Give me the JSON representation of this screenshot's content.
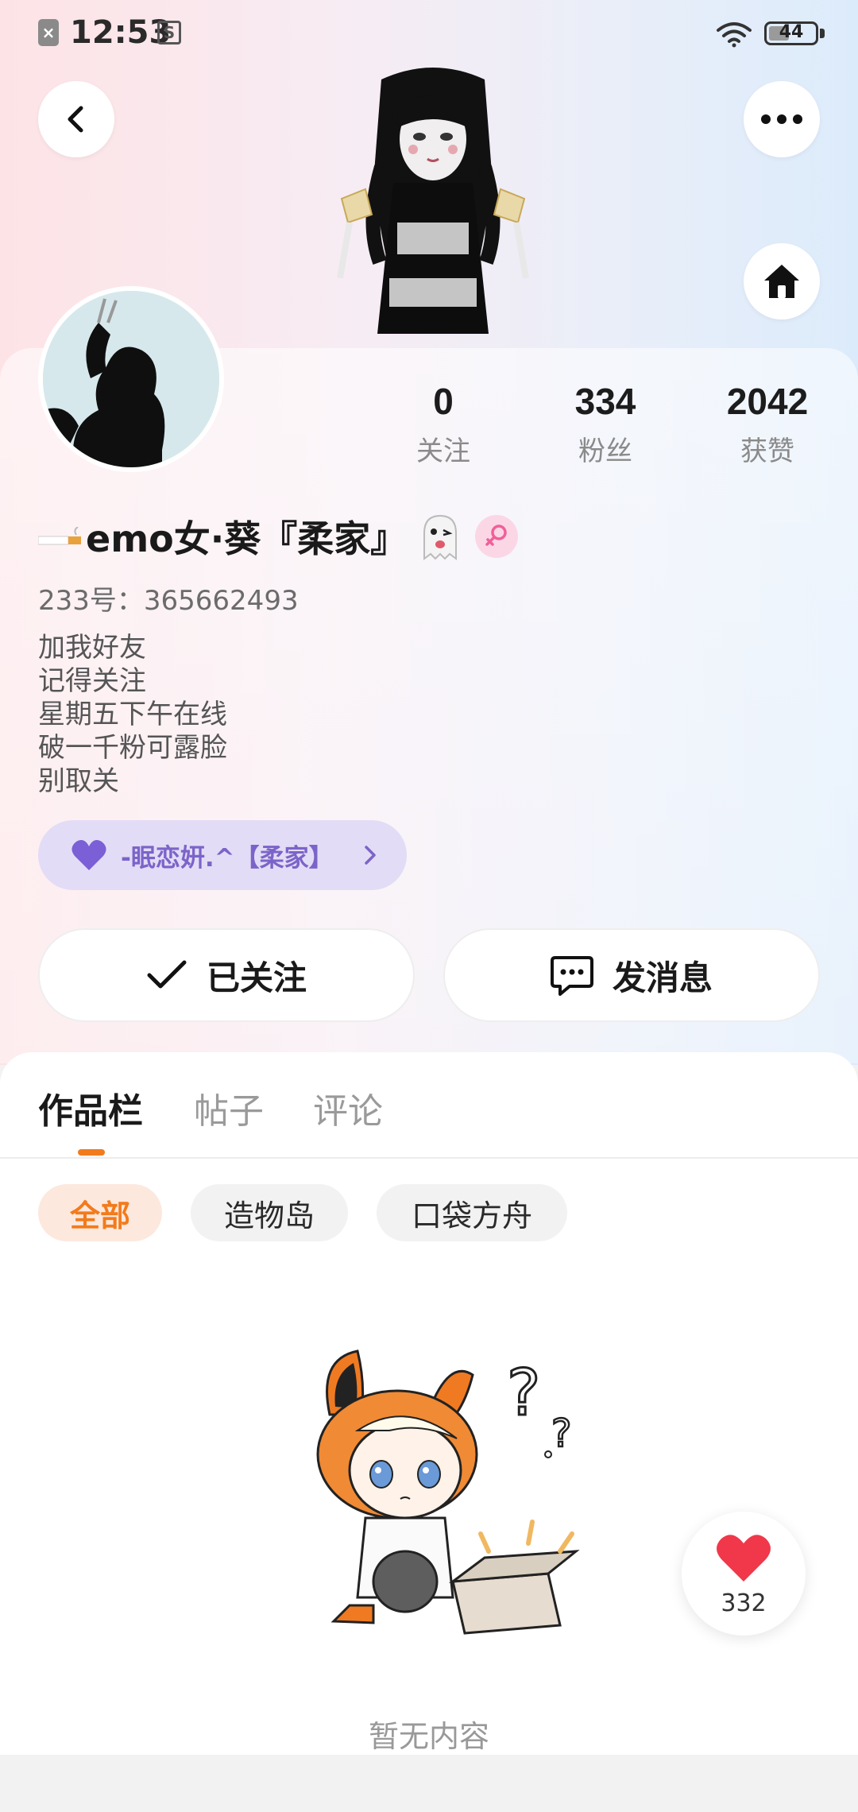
{
  "status_bar": {
    "time": "12:53",
    "battery": "44",
    "notification_icon": "close-square-icon",
    "sim_icon": "s-square-icon",
    "wifi_icon": "wifi-icon"
  },
  "header": {
    "back_icon": "chevron-left-icon",
    "more_icon": "more-dots-icon",
    "home_icon": "home-icon"
  },
  "stats": [
    {
      "value": "0",
      "label": "关注"
    },
    {
      "value": "334",
      "label": "粉丝"
    },
    {
      "value": "2042",
      "label": "获赞"
    }
  ],
  "profile": {
    "name": "emo女·葵『柔家』",
    "id_line": "233号：365662493",
    "bio": [
      "加我好友",
      "记得关注",
      "星期五下午在线",
      "破一千粉可露脸",
      "别取关"
    ],
    "gender_icon": "female-symbol-icon"
  },
  "group": {
    "label": "-眠恋姸.^【柔家】",
    "icon": "heart-icon"
  },
  "actions": {
    "follow_label": "已关注",
    "message_label": "发消息"
  },
  "tabs": [
    "作品栏",
    "帖子",
    "评论"
  ],
  "filters": [
    "全部",
    "造物岛",
    "口袋方舟"
  ],
  "empty": {
    "text": "暂无内容"
  },
  "like": {
    "count": "332"
  },
  "colors": {
    "accent": "#f27b1c",
    "group_pill_bg": "#e3dcf6",
    "group_pill_text": "#7b64c9",
    "heart": "#f0384a"
  }
}
